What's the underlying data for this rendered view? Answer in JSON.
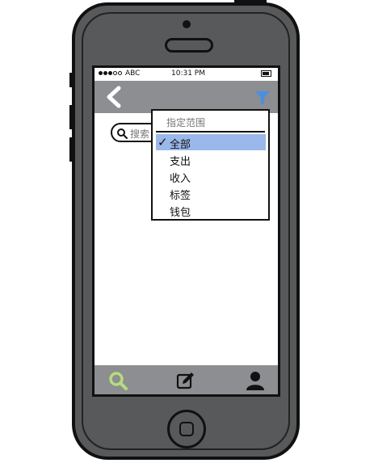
{
  "status_bar": {
    "carrier": "ABC",
    "time": "10:31 PM"
  },
  "nav_bar": {
    "back_icon": "chevron-left-icon",
    "filter_icon": "filter-icon",
    "filter_color": "#4a90e2"
  },
  "search": {
    "icon": "search-icon",
    "placeholder": "搜索"
  },
  "dropdown": {
    "header": "指定范围",
    "items": [
      {
        "label": "全部",
        "selected": true
      },
      {
        "label": "支出",
        "selected": false
      },
      {
        "label": "收入",
        "selected": false
      },
      {
        "label": "标签",
        "selected": false
      },
      {
        "label": "钱包",
        "selected": false
      }
    ],
    "check_mark": "✓",
    "selected_color": "#9bb8ea"
  },
  "tab_bar": {
    "tabs": [
      {
        "icon": "search-icon",
        "color": "#b6dc7e"
      },
      {
        "icon": "edit-icon",
        "color": "#111111"
      },
      {
        "icon": "user-icon",
        "color": "#111111"
      }
    ]
  }
}
